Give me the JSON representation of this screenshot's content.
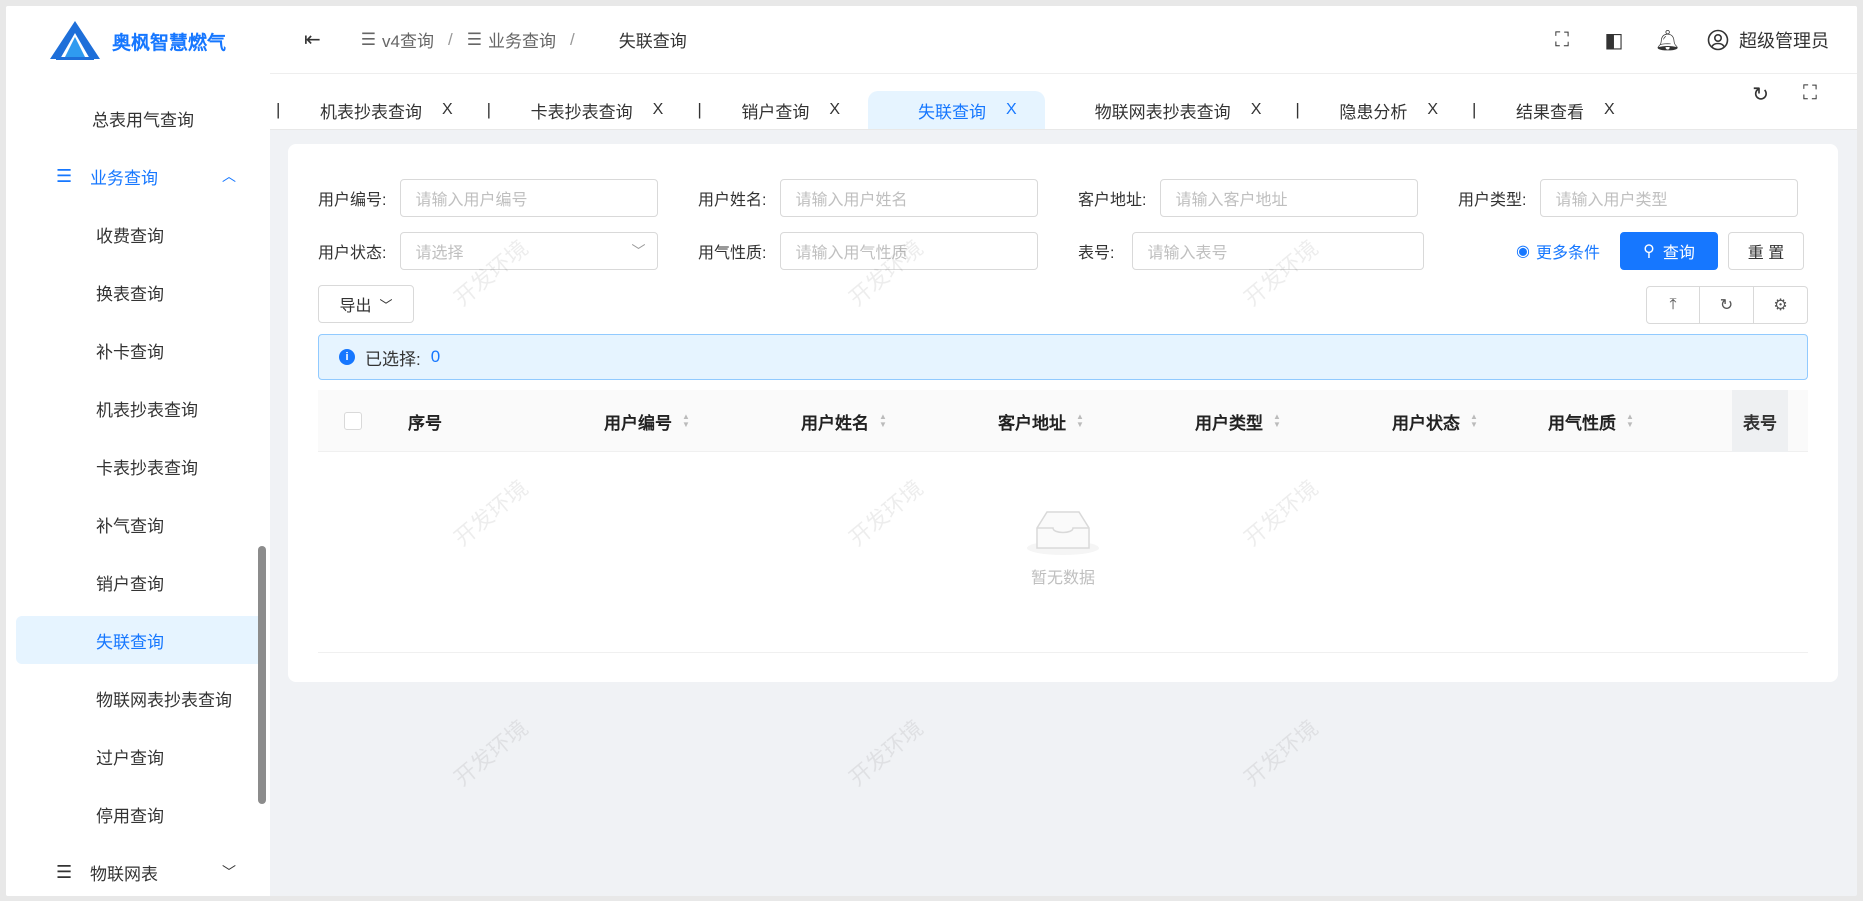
{
  "app": {
    "name": "奥枫智慧燃气"
  },
  "sidebar": {
    "items": [
      {
        "label": "总表用气查询",
        "level": "sub"
      },
      {
        "label": "业务查询",
        "level": "group",
        "open": true
      },
      {
        "label": "收费查询",
        "level": "sub"
      },
      {
        "label": "换表查询",
        "level": "sub"
      },
      {
        "label": "补卡查询",
        "level": "sub"
      },
      {
        "label": "机表抄表查询",
        "level": "sub"
      },
      {
        "label": "卡表抄表查询",
        "level": "sub"
      },
      {
        "label": "补气查询",
        "level": "sub"
      },
      {
        "label": "销户查询",
        "level": "sub"
      },
      {
        "label": "失联查询",
        "level": "sub",
        "active": true
      },
      {
        "label": "物联网表抄表查询",
        "level": "sub"
      },
      {
        "label": "过户查询",
        "level": "sub"
      },
      {
        "label": "停用查询",
        "level": "sub"
      },
      {
        "label": "物联网表",
        "level": "group",
        "open": false
      }
    ]
  },
  "header": {
    "breadcrumb": [
      "v4查询",
      "业务查询",
      "失联查询"
    ],
    "separator": "/",
    "user": "超级管理员",
    "icons": [
      "fullscreen-icon",
      "theme-icon",
      "notification-icon",
      "user-icon"
    ]
  },
  "tabs": [
    {
      "label": "机表抄表查询",
      "close": "X"
    },
    {
      "label": "卡表抄表查询",
      "close": "X"
    },
    {
      "label": "销户查询",
      "close": "X"
    },
    {
      "label": "失联查询",
      "close": "X",
      "active": true
    },
    {
      "label": "物联网表抄表查询",
      "close": "X"
    },
    {
      "label": "隐患分析",
      "close": "X"
    },
    {
      "label": "结果查看",
      "close": "X"
    }
  ],
  "form": {
    "user_no": {
      "label": "用户编号:",
      "placeholder": "请输入用户编号"
    },
    "user_name": {
      "label": "用户姓名:",
      "placeholder": "请输入用户姓名"
    },
    "address": {
      "label": "客户地址:",
      "placeholder": "请输入客户地址"
    },
    "user_type": {
      "label": "用户类型:",
      "placeholder": "请输入用户类型"
    },
    "user_status": {
      "label": "用户状态:",
      "placeholder": "请选择"
    },
    "gas_nature": {
      "label": "用气性质:",
      "placeholder": "请输入用气性质"
    },
    "meter_no": {
      "label": "表号:",
      "placeholder": "请输入表号"
    },
    "more": "更多条件",
    "search": "查询",
    "reset": "重 置",
    "export": "导出"
  },
  "selection": {
    "label": "已选择:",
    "count": "0"
  },
  "table": {
    "columns": [
      "序号",
      "用户编号",
      "用户姓名",
      "客户地址",
      "用户类型",
      "用户状态",
      "用气性质",
      "表号"
    ],
    "rows": [],
    "empty_text": "暂无数据"
  },
  "watermark": "开发环境",
  "colors": {
    "primary": "#1677ff",
    "active_bg": "#e6f4ff"
  }
}
